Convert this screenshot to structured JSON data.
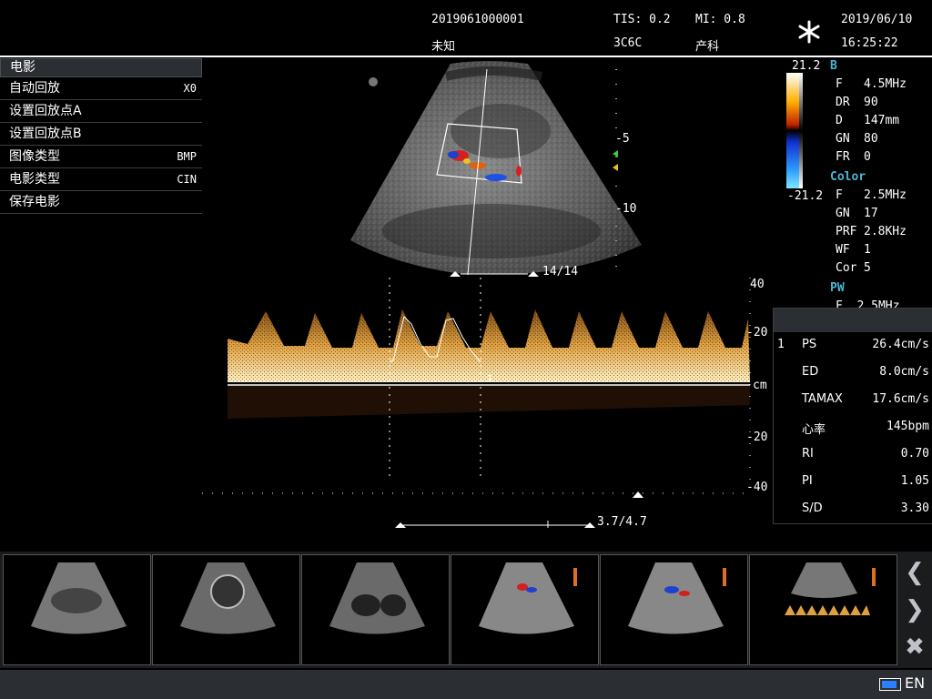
{
  "header": {
    "patient_id": "2019061000001",
    "patient_name": "未知",
    "tis": "TIS: 0.2",
    "mi": "MI: 0.8",
    "probe": "3C6C",
    "exam": "产科",
    "date": "2019/06/10",
    "time": "16:25:22",
    "freeze_icon": "snowflake-icon"
  },
  "cine_menu": {
    "title": "电影",
    "items": [
      {
        "label": "自动回放",
        "value": "X0"
      },
      {
        "label": "设置回放点A",
        "value": ""
      },
      {
        "label": "设置回放点B",
        "value": ""
      },
      {
        "label": "图像类型",
        "value": "BMP"
      },
      {
        "label": "电影类型",
        "value": "CIN"
      },
      {
        "label": "保存电影",
        "value": ""
      }
    ]
  },
  "colorbar": {
    "top": "21.2",
    "bottom": "-21.2"
  },
  "params": {
    "b_title": "B",
    "b": [
      {
        "k": "F",
        "v": "4.5MHz"
      },
      {
        "k": "DR",
        "v": "90"
      },
      {
        "k": "D",
        "v": "147mm"
      },
      {
        "k": "GN",
        "v": "80"
      },
      {
        "k": "FR",
        "v": "0"
      }
    ],
    "color_title": "Color",
    "color": [
      {
        "k": "F",
        "v": "2.5MHz"
      },
      {
        "k": "GN",
        "v": "17"
      },
      {
        "k": "PRF",
        "v": "2.8KHz"
      },
      {
        "k": "WF",
        "v": "1"
      },
      {
        "k": "Cor",
        "v": "5"
      }
    ],
    "pw_title": "PW",
    "pw_partial": {
      "k": "F",
      "v": "2.5MHz"
    }
  },
  "bmode": {
    "depth_ticks": [
      "-5",
      "-10"
    ],
    "frame_counter": "14/14"
  },
  "doppler": {
    "axis_top": "40",
    "axis_labels": [
      "20",
      "cm",
      "-20",
      "-40"
    ],
    "cursor_label": "1",
    "bottom_counter": "3.7/4.7"
  },
  "measurements": {
    "index": "1",
    "rows": [
      {
        "label": "PS",
        "value": "26.4cm/s"
      },
      {
        "label": "ED",
        "value": "8.0cm/s"
      },
      {
        "label": "TAMAX",
        "value": "17.6cm/s"
      },
      {
        "label": "心率",
        "value": "145bpm"
      },
      {
        "label": "RI",
        "value": "0.70"
      },
      {
        "label": "PI",
        "value": "1.05"
      },
      {
        "label": "S/D",
        "value": "3.30"
      }
    ]
  },
  "thumbnails": [
    {
      "name": "thumb-1"
    },
    {
      "name": "thumb-2"
    },
    {
      "name": "thumb-3"
    },
    {
      "name": "thumb-4"
    },
    {
      "name": "thumb-5"
    },
    {
      "name": "thumb-6"
    }
  ],
  "nav": {
    "prev_icon": "chevron-left-icon",
    "next_icon": "chevron-right-icon",
    "close_icon": "close-icon"
  },
  "status": {
    "lang": "EN",
    "battery_icon": "battery-icon"
  }
}
